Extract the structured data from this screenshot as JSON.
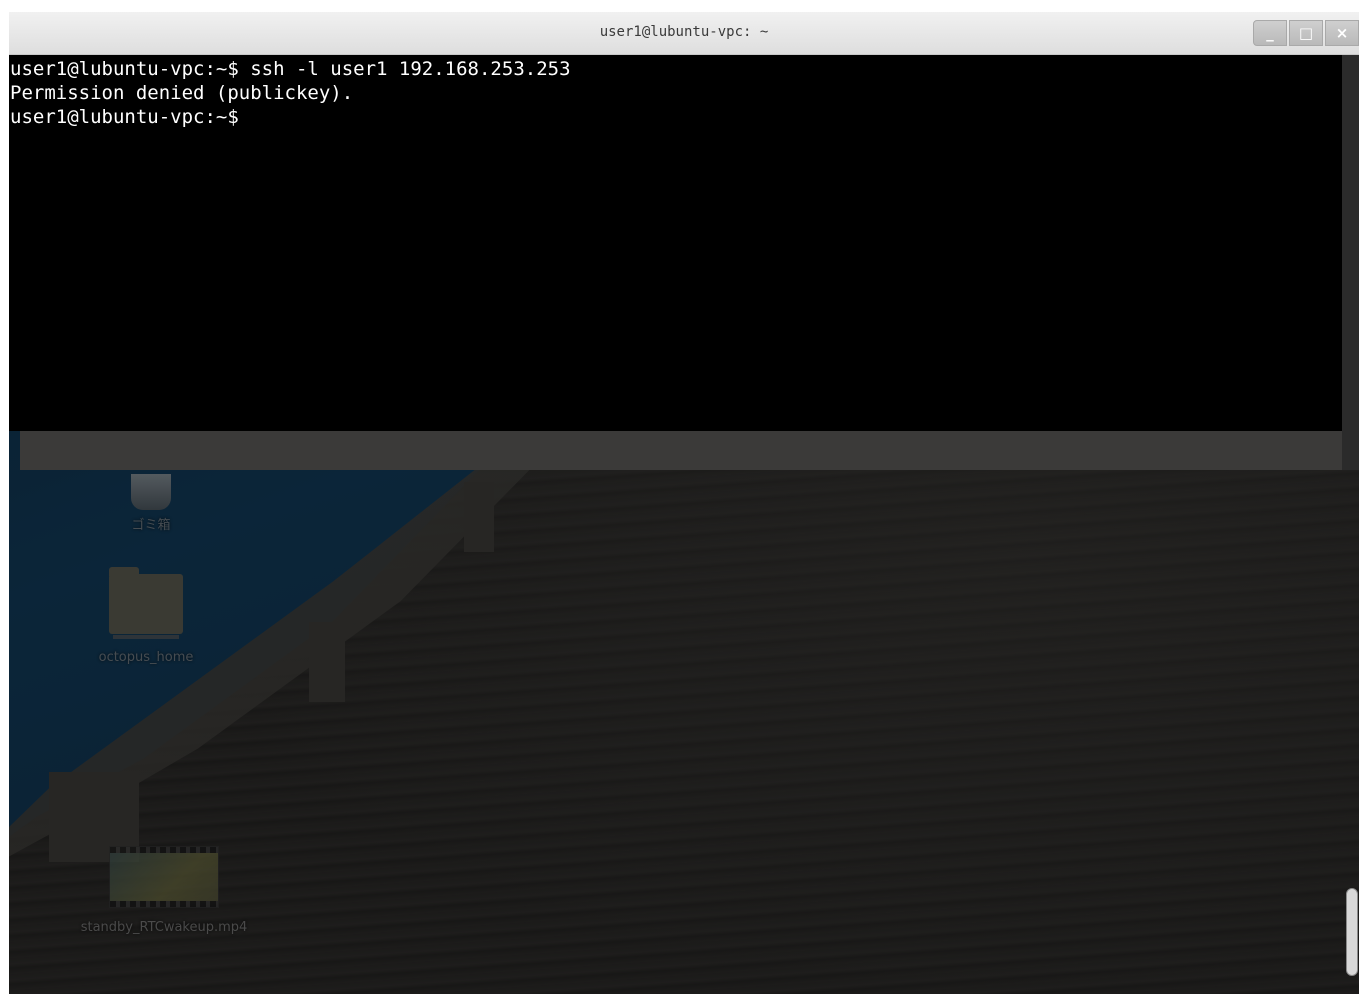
{
  "window": {
    "title": "user1@lubuntu-vpc: ~",
    "controls": {
      "minimize": "_",
      "maximize": "□",
      "close": "×"
    }
  },
  "terminal": {
    "lines": [
      "user1@lubuntu-vpc:~$ ssh -l user1 192.168.253.253",
      "Permission denied (publickey).",
      "user1@lubuntu-vpc:~$"
    ],
    "background": "#000000",
    "foreground": "#ffffff"
  },
  "desktop": {
    "icons": [
      {
        "label": "ゴミ箱",
        "icon": "trash-icon"
      },
      {
        "label": "octopus_home",
        "icon": "folder-icon"
      },
      {
        "label": "standby_RTCwakeup.mp4",
        "icon": "video-file-icon"
      }
    ]
  }
}
